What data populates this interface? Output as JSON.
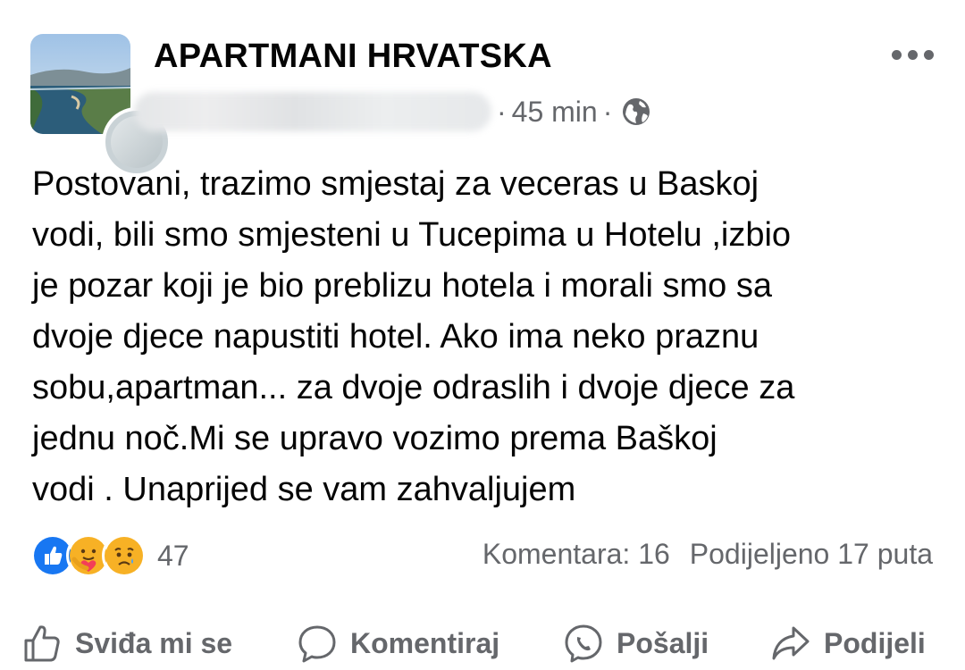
{
  "post": {
    "group_name": "APARTMANI HRVATSKA",
    "time_separator": "·",
    "time": "45 min",
    "audience_icon": "globe-icon",
    "text": [
      "Postovani, trazimo smjestaj za veceras u Baskoj",
      "vodi, bili smo smjesteni u Tucepima u Hotelu ,izbio",
      "je pozar koji je bio preblizu hotela i morali smo sa",
      "dvoje djece napustiti hotel. Ako ima neko praznu",
      "sobu,apartman... za dvoje odraslih i dvoje djece za",
      "jednu noč.Mi se upravo vozimo prema Baškoj",
      "vodi . Unaprijed se vam zahvaljujem"
    ]
  },
  "stats": {
    "reaction_icons": [
      "like-icon",
      "care-icon",
      "sad-icon"
    ],
    "reaction_count": "47",
    "comments": "Komentara: 16",
    "shares": "Podijeljeno 17 puta"
  },
  "actions": {
    "like": "Sviđa mi se",
    "comment": "Komentiraj",
    "send": "Pošalji",
    "share": "Podijeli"
  },
  "colors": {
    "text": "#050505",
    "secondary": "#65676b",
    "like_blue": "#1877f2",
    "reaction_yellow": "#f7b125"
  }
}
